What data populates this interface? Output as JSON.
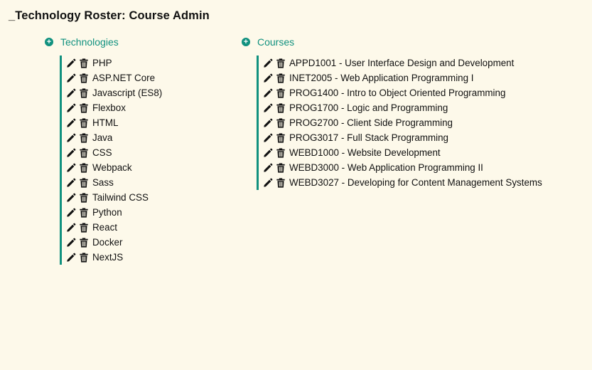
{
  "page": {
    "title": "_Technology Roster: Course Admin"
  },
  "colors": {
    "accent": "#11917f",
    "background": "#fdf9ea",
    "icon": "#111111"
  },
  "icons": {
    "add": "plus-circle-icon",
    "edit": "pencil-icon",
    "delete": "trash-icon"
  },
  "technologies": {
    "header": "Technologies",
    "items": [
      "PHP",
      "ASP.NET Core",
      "Javascript (ES8)",
      "Flexbox",
      "HTML",
      "Java",
      "CSS",
      "Webpack",
      "Sass",
      "Tailwind CSS",
      "Python",
      "React",
      "Docker",
      "NextJS"
    ]
  },
  "courses": {
    "header": "Courses",
    "items": [
      "APPD1001 - User Interface Design and Development",
      "INET2005 - Web Application Programming I",
      "PROG1400 - Intro to Object Oriented Programming",
      "PROG1700 - Logic and Programming",
      "PROG2700 - Client Side Programming",
      "PROG3017 - Full Stack Programming",
      "WEBD1000 - Website Development",
      "WEBD3000 - Web Application Programming II",
      "WEBD3027 - Developing for Content Management Systems"
    ]
  }
}
